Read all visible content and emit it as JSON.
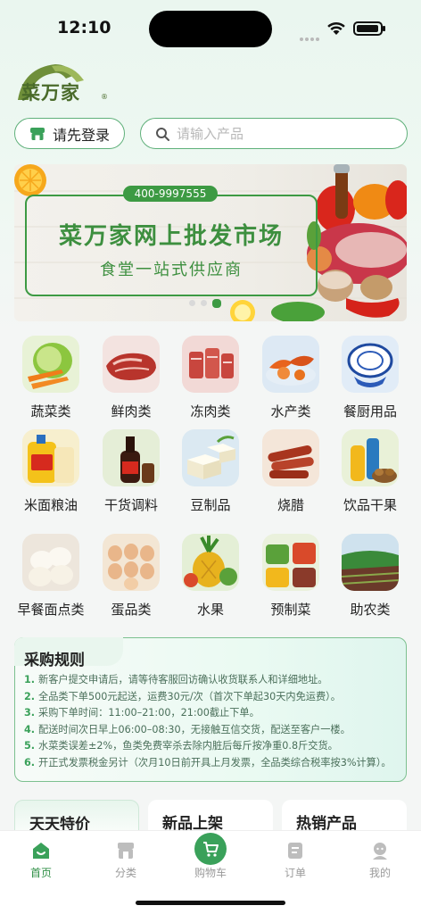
{
  "status": {
    "time": "12:10"
  },
  "brand": {
    "name": "菜万家",
    "registered": "®"
  },
  "header": {
    "login_label": "请先登录",
    "search_placeholder": "请输入产品"
  },
  "banner": {
    "phone": "400-9997555",
    "title": "菜万家网上批发市场",
    "subtitle": "食堂一站式供应商"
  },
  "categories": [
    {
      "label": "蔬菜类",
      "icon": "vegetables-icon"
    },
    {
      "label": "鲜肉类",
      "icon": "fresh-meat-icon"
    },
    {
      "label": "冻肉类",
      "icon": "frozen-meat-icon"
    },
    {
      "label": "水产类",
      "icon": "seafood-icon"
    },
    {
      "label": "餐厨用品",
      "icon": "tableware-icon"
    },
    {
      "label": "米面粮油",
      "icon": "rice-oil-icon"
    },
    {
      "label": "干货调料",
      "icon": "seasoning-icon"
    },
    {
      "label": "豆制品",
      "icon": "tofu-icon"
    },
    {
      "label": "烧腊",
      "icon": "roast-meat-icon"
    },
    {
      "label": "饮品干果",
      "icon": "drinks-nuts-icon"
    },
    {
      "label": "早餐面点类",
      "icon": "buns-icon"
    },
    {
      "label": "蛋品类",
      "icon": "eggs-icon"
    },
    {
      "label": "水果",
      "icon": "fruit-icon"
    },
    {
      "label": "预制菜",
      "icon": "prepared-food-icon"
    },
    {
      "label": "助农类",
      "icon": "farm-icon"
    }
  ],
  "rules": {
    "title": "采购规则",
    "items": [
      {
        "num": "1.",
        "text": "新客户提交申请后，请等待客服回访确认收货联系人和详细地址。"
      },
      {
        "num": "2.",
        "text": "全品类下单500元起送，运费30元/次（首次下单起30天内免运费）。"
      },
      {
        "num": "3.",
        "text": "采购下单时间：11:00–21:00，21:00截止下单。"
      },
      {
        "num": "4.",
        "text": "配送时间次日早上06:00–08:30，无接触互信交货，配送至客户一楼。"
      },
      {
        "num": "5.",
        "text": "水菜类误差±2%，鱼类免费宰杀去除内脏后每斤按净重0.8斤交货。"
      },
      {
        "num": "6.",
        "text": "开正式发票税金另计（次月10日前开具上月发票，全品类综合税率按3%计算）。"
      }
    ]
  },
  "sections": {
    "daily_special": "天天特价",
    "new_products": "新品上架",
    "hot_products": "热销产品"
  },
  "tabbar": [
    {
      "label": "首页",
      "icon": "home-icon"
    },
    {
      "label": "分类",
      "icon": "category-icon"
    },
    {
      "label": "购物车",
      "icon": "cart-icon"
    },
    {
      "label": "订单",
      "icon": "order-icon"
    },
    {
      "label": "我的",
      "icon": "profile-icon"
    }
  ],
  "colors": {
    "accent": "#3aa15a",
    "brand_text": "#4a6b2a"
  }
}
